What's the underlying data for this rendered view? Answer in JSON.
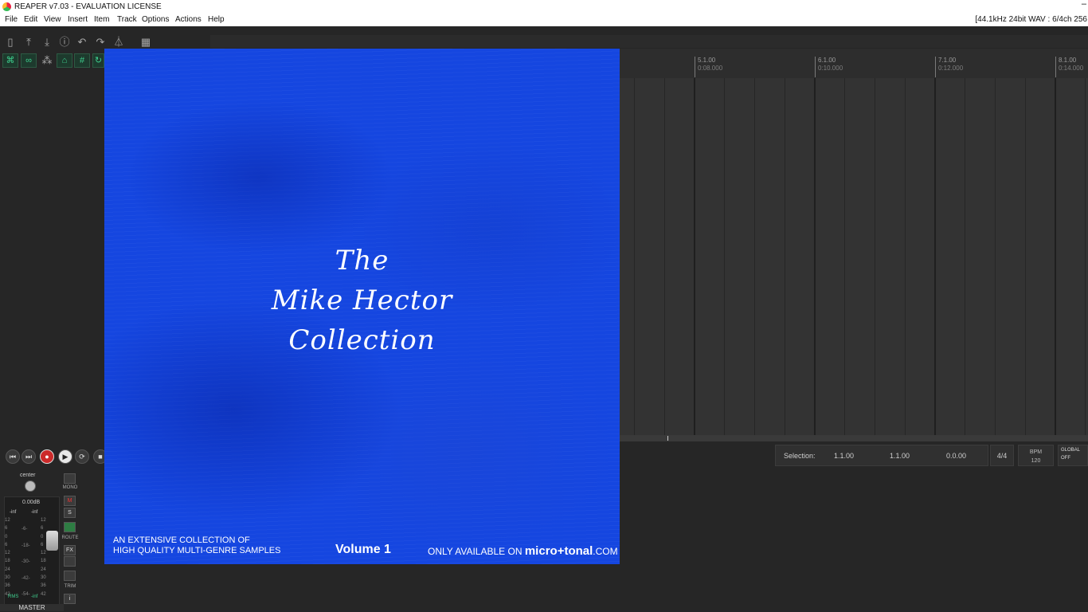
{
  "window": {
    "title": "REAPER v7.03 - EVALUATION LICENSE",
    "minimize": "–"
  },
  "menu": {
    "items": [
      "File",
      "Edit",
      "View",
      "Insert",
      "Item",
      "Track",
      "Options",
      "Actions",
      "Help"
    ],
    "status": "[44.1kHz 24bit WAV : 6/4ch 256"
  },
  "toolbar": {
    "row1_icons": [
      "new-project-icon",
      "open-project-icon",
      "save-project-icon",
      "project-settings-icon",
      "undo-icon",
      "redo-icon",
      "metronome-icon",
      "grid-icon"
    ],
    "row2_icons": [
      "ripple-edit-icon",
      "link-icon",
      "snap-grid-icon",
      "envelope-icon",
      "grid-lines-icon",
      "loop-icon"
    ]
  },
  "timeline": {
    "markers": [
      {
        "bar": "5.1.00",
        "time": "0:08.000"
      },
      {
        "bar": "6.1.00",
        "time": "0:10.000"
      },
      {
        "bar": "7.1.00",
        "time": "0:12.000"
      },
      {
        "bar": "8.1.00",
        "time": "0:14.000"
      }
    ]
  },
  "transport": {
    "selection_label": "Selection:",
    "sel_start": "1.1.00",
    "sel_end": "1.1.00",
    "sel_length": "0.0.00",
    "time_signature": "4/4",
    "bpm_label": "BPM",
    "bpm_value": "120",
    "global_label": "GLOBAL",
    "global_value": "OFF"
  },
  "master": {
    "pan": "center",
    "volume": "0.00dB",
    "peak_left": "-inf",
    "peak_right": "-inf",
    "scale": [
      "12",
      "6",
      "0",
      "6",
      "12",
      "18",
      "24",
      "30",
      "36",
      "42"
    ],
    "inner_scale": [
      "-6-",
      "-18-",
      "-30-",
      "-42-",
      "-54-"
    ],
    "rms_label": "RMS",
    "rms_value": "-inf",
    "name": "MASTER",
    "mono": "MONO",
    "mute": "M",
    "solo": "S",
    "route": "ROUTE",
    "fx": "FX",
    "trim": "TRIM",
    "info": "i"
  },
  "cover": {
    "title_line1": "The",
    "title_line2": "Mike Hector",
    "title_line3": "Collection",
    "tagline_line1": "AN EXTENSIVE COLLECTION OF",
    "tagline_line2": "HIGH QUALITY MULTI-GENRE SAMPLES",
    "volume": "Volume 1",
    "avail_prefix": "ONLY AVAILABLE ON",
    "brand": "micro+tonal",
    "brand_suffix": ".COM"
  }
}
